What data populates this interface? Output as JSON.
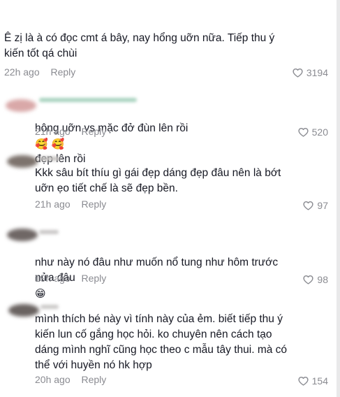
{
  "comments": [
    {
      "text": "Ê zị là à có đọc cmt á bây, nay hổng uỡn nữa. Tiếp thu ý\nkiến tốt qá chùi",
      "time": "22h ago",
      "reply": "Reply",
      "likes": "3194",
      "has_avatar": false
    },
    {
      "text": "hông uỡn vs mặc đở đùn lên rồi",
      "text_after": "đẹp lên rồi",
      "emoji": "🥰 🥰",
      "time": "21h ago",
      "reply": "Reply",
      "likes": "520",
      "has_avatar": true
    },
    {
      "text": "Kkk sâu bít thíu gì gái đẹp dáng đẹp đâu nên là bớt\nuỡn ẹo tiết chế là sẽ đẹp bền.",
      "time": "21h ago",
      "reply": "Reply",
      "likes": "97",
      "has_avatar": true
    },
    {
      "text": "như này nó đâu như muốn nổ tung như hôm trước\nnửa đâu",
      "emoji": "😁",
      "time": "19h ago",
      "reply": "Reply",
      "likes": "98",
      "has_avatar": true
    },
    {
      "text": "mình thích bé này vì tính này của ẻm. biết tiếp thu ý\nkiến lun cố gắng học hỏi. ko chuyên nên cách tạo\ndáng mình nghĩ cũng học theo c mẫu tây thui. mà có\nthể với huyền nó hk hợp",
      "time": "20h ago",
      "reply": "Reply",
      "likes": "154",
      "has_avatar": true
    }
  ],
  "colors": {
    "text": "#161823",
    "meta": "#8a8b91",
    "background": "#ffffff"
  },
  "icons": {
    "like": "heart-outline-icon"
  }
}
